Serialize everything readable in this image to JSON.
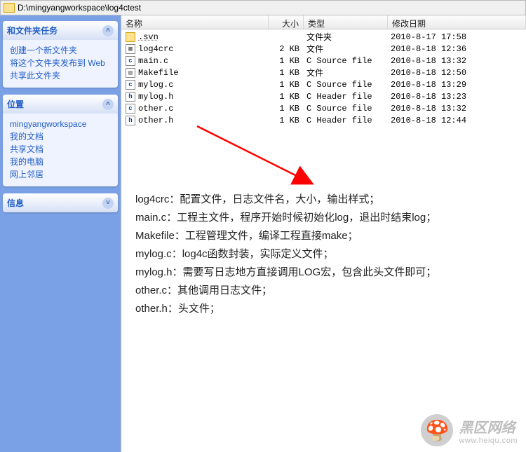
{
  "address": "D:\\mingyangworkspace\\log4ctest",
  "columns": {
    "name": "名称",
    "size": "大小",
    "type": "类型",
    "date": "修改日期"
  },
  "sidebar": {
    "panels": [
      {
        "title": "和文件夹任务",
        "items": [
          "创建一个新文件夹",
          "将这个文件夹发布到 Web",
          "共享此文件夹"
        ]
      },
      {
        "title": "位置",
        "items": [
          "mingyangworkspace",
          "我的文档",
          "共享文档",
          "我的电脑",
          "网上邻居"
        ]
      },
      {
        "title": "信息",
        "items": []
      }
    ]
  },
  "files": [
    {
      "icon": "folder",
      "name": ".svn",
      "size": "",
      "type": "文件夹",
      "date": "2010-8-17 17:58"
    },
    {
      "icon": "doc",
      "name": "log4crc",
      "size": "2 KB",
      "type": "文件",
      "date": "2010-8-18 12:36"
    },
    {
      "icon": "c",
      "name": "main.c",
      "size": "1 KB",
      "type": "C Source file",
      "date": "2010-8-18 13:32"
    },
    {
      "icon": "mk",
      "name": "Makefile",
      "size": "1 KB",
      "type": "文件",
      "date": "2010-8-18 12:50"
    },
    {
      "icon": "c",
      "name": "mylog.c",
      "size": "1 KB",
      "type": "C Source file",
      "date": "2010-8-18 13:29"
    },
    {
      "icon": "h",
      "name": "mylog.h",
      "size": "1 KB",
      "type": "C Header file",
      "date": "2010-8-18 13:23"
    },
    {
      "icon": "c",
      "name": "other.c",
      "size": "1 KB",
      "type": "C Source file",
      "date": "2010-8-18 13:32"
    },
    {
      "icon": "h",
      "name": "other.h",
      "size": "1 KB",
      "type": "C Header file",
      "date": "2010-8-18 12:44"
    }
  ],
  "annotations": [
    {
      "key": "log4crc",
      "desc": "配置文件，日志文件名，大小，输出样式；"
    },
    {
      "key": "main.c",
      "desc": "工程主文件，程序开始时候初始化log，退出时结束log；"
    },
    {
      "key": "Makefile",
      "desc": "工程管理文件，编译工程直接make；"
    },
    {
      "key": "mylog.c",
      "desc": "log4c函数封装，实际定义文件；"
    },
    {
      "key": "mylog.h",
      "desc": "需要写日志地方直接调用LOG宏，包含此头文件即可；"
    },
    {
      "key": "other.c",
      "desc": "其他调用日志文件；"
    },
    {
      "key": "other.h",
      "desc": "头文件；"
    }
  ],
  "watermark": {
    "cn": "黑区网络",
    "en": "www.heiqu.com"
  }
}
